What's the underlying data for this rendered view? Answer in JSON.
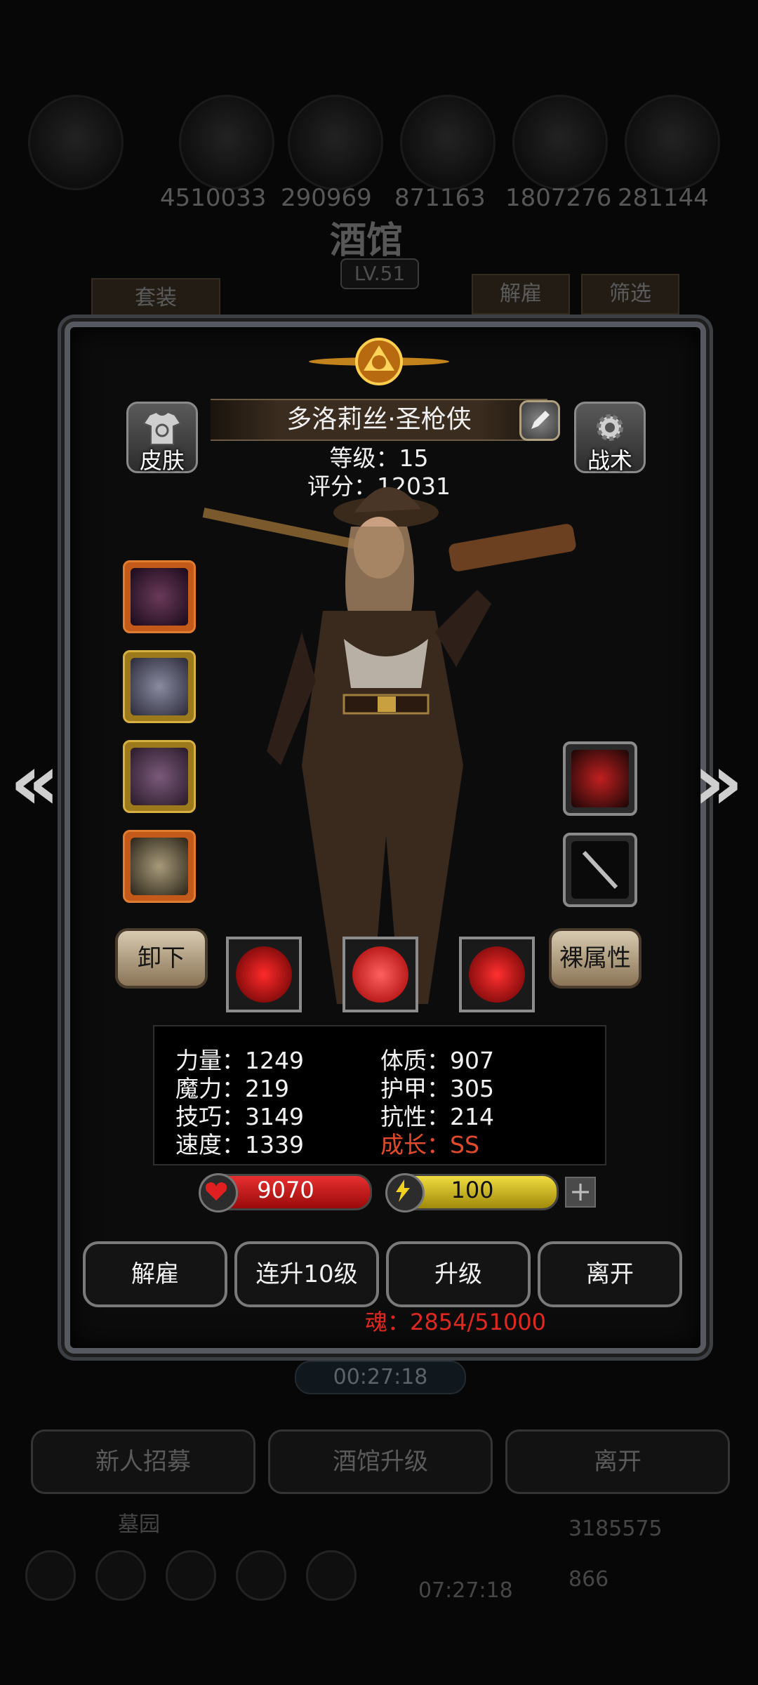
{
  "background": {
    "resources": [
      "4510033",
      "290969",
      "871163",
      "1807276",
      "281144"
    ],
    "title": "酒馆",
    "level": "LV.51",
    "tabs": [
      "套装",
      "解雇",
      "筛选"
    ],
    "timer": "00:27:18",
    "bottom_buttons": [
      "新人招募",
      "酒馆升级",
      "离开"
    ],
    "footer_label": "墓园",
    "gold": "3185575",
    "gems": "866",
    "footer_timer": "07:27:18"
  },
  "hero": {
    "name": "多洛莉丝·圣枪侠",
    "level_line": "等级：15",
    "score_line": "评分：12031",
    "skin_label": "皮肤",
    "tactics_label": "战术"
  },
  "actions": {
    "unequip": "卸下",
    "base_attr": "裸属性"
  },
  "stats": [
    {
      "label": "力量：1249"
    },
    {
      "label": "魔力：219"
    },
    {
      "label": "技巧：3149"
    },
    {
      "label": "速度：1339"
    },
    {
      "label": "体质：907"
    },
    {
      "label": "护甲：305"
    },
    {
      "label": "抗性：214"
    },
    {
      "label": "成长：SS"
    }
  ],
  "hp": "9070",
  "energy": "100",
  "buttons": [
    "解雇",
    "连升10级",
    "升级",
    "离开"
  ],
  "soul": "魂：2854/51000",
  "colors": {
    "hp": "#d41c1c",
    "energy": "#d9c21a",
    "growth": "#e34a2a",
    "soul": "#e0281e"
  },
  "icons": [
    "skin-icon",
    "tactics-gear-icon",
    "left-arrow-icon",
    "right-arrow-icon",
    "edit-icon",
    "badge-icon"
  ]
}
